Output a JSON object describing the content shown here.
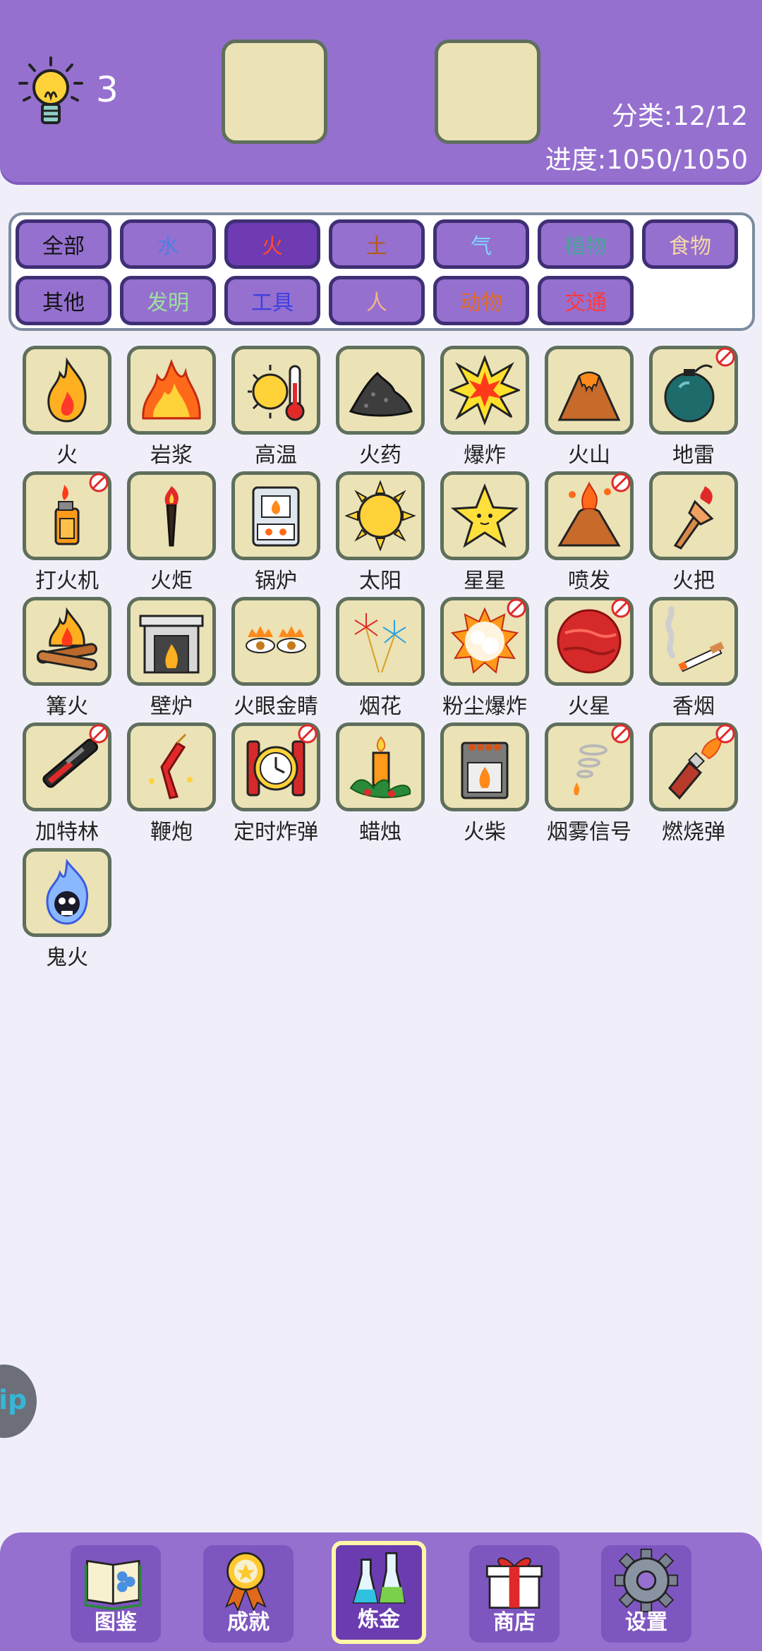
{
  "header": {
    "hint_count": "3",
    "category_stat": "分类:12/12",
    "progress_stat": "进度:1050/1050"
  },
  "filters": [
    {
      "label": "全部",
      "color": "#111111",
      "active": false
    },
    {
      "label": "水",
      "color": "#4f7fe0",
      "active": false
    },
    {
      "label": "火",
      "color": "#ff4a2a",
      "active": true
    },
    {
      "label": "土",
      "color": "#b35a1f",
      "active": false
    },
    {
      "label": "气",
      "color": "#7fd4ff",
      "active": false
    },
    {
      "label": "植物",
      "color": "#4aa59a",
      "active": false
    },
    {
      "label": "食物",
      "color": "#f3d9a8",
      "active": false
    },
    {
      "label": "其他",
      "color": "#111111",
      "active": false
    },
    {
      "label": "发明",
      "color": "#9de0a0",
      "active": false
    },
    {
      "label": "工具",
      "color": "#3f3fe0",
      "active": false
    },
    {
      "label": "人",
      "color": "#f0b38a",
      "active": false
    },
    {
      "label": "动物",
      "color": "#e06a2a",
      "active": false
    },
    {
      "label": "交通",
      "color": "#ff3a3a",
      "active": false
    }
  ],
  "items": [
    {
      "label": "火",
      "icon": "fire-icon",
      "locked": false
    },
    {
      "label": "岩浆",
      "icon": "lava-icon",
      "locked": false
    },
    {
      "label": "高温",
      "icon": "heat-icon",
      "locked": false
    },
    {
      "label": "火药",
      "icon": "gunpowder-icon",
      "locked": false
    },
    {
      "label": "爆炸",
      "icon": "explosion-icon",
      "locked": false
    },
    {
      "label": "火山",
      "icon": "volcano-icon",
      "locked": false
    },
    {
      "label": "地雷",
      "icon": "landmine-icon",
      "locked": true
    },
    {
      "label": "打火机",
      "icon": "lighter-icon",
      "locked": true
    },
    {
      "label": "火炬",
      "icon": "torch-icon",
      "locked": false
    },
    {
      "label": "锅炉",
      "icon": "boiler-icon",
      "locked": false
    },
    {
      "label": "太阳",
      "icon": "sun-icon",
      "locked": false
    },
    {
      "label": "星星",
      "icon": "star-icon",
      "locked": false
    },
    {
      "label": "喷发",
      "icon": "eruption-icon",
      "locked": true
    },
    {
      "label": "火把",
      "icon": "firebrand-icon",
      "locked": false
    },
    {
      "label": "篝火",
      "icon": "bonfire-icon",
      "locked": false
    },
    {
      "label": "壁炉",
      "icon": "fireplace-icon",
      "locked": false
    },
    {
      "label": "火眼金睛",
      "icon": "fiery-eyes-icon",
      "locked": false
    },
    {
      "label": "烟花",
      "icon": "fireworks-icon",
      "locked": false
    },
    {
      "label": "粉尘爆炸",
      "icon": "dust-explosion-icon",
      "locked": true
    },
    {
      "label": "火星",
      "icon": "mars-icon",
      "locked": true
    },
    {
      "label": "香烟",
      "icon": "cigarette-icon",
      "locked": false
    },
    {
      "label": "加特林",
      "icon": "gatling-icon",
      "locked": true
    },
    {
      "label": "鞭炮",
      "icon": "firecracker-icon",
      "locked": false
    },
    {
      "label": "定时炸弹",
      "icon": "time-bomb-icon",
      "locked": true
    },
    {
      "label": "蜡烛",
      "icon": "candle-icon",
      "locked": false
    },
    {
      "label": "火柴",
      "icon": "matches-icon",
      "locked": false
    },
    {
      "label": "烟雾信号",
      "icon": "smoke-signal-icon",
      "locked": true
    },
    {
      "label": "燃烧弹",
      "icon": "molotov-icon",
      "locked": true
    },
    {
      "label": "鬼火",
      "icon": "ghost-fire-icon",
      "locked": false
    }
  ],
  "side_tab": {
    "text": "ip"
  },
  "nav": [
    {
      "label": "图鉴",
      "icon": "book-icon",
      "active": false
    },
    {
      "label": "成就",
      "icon": "medal-icon",
      "active": false
    },
    {
      "label": "炼金",
      "icon": "flask-icon",
      "active": true
    },
    {
      "label": "商店",
      "icon": "gift-icon",
      "active": false
    },
    {
      "label": "设置",
      "icon": "gear-icon",
      "active": false
    }
  ]
}
